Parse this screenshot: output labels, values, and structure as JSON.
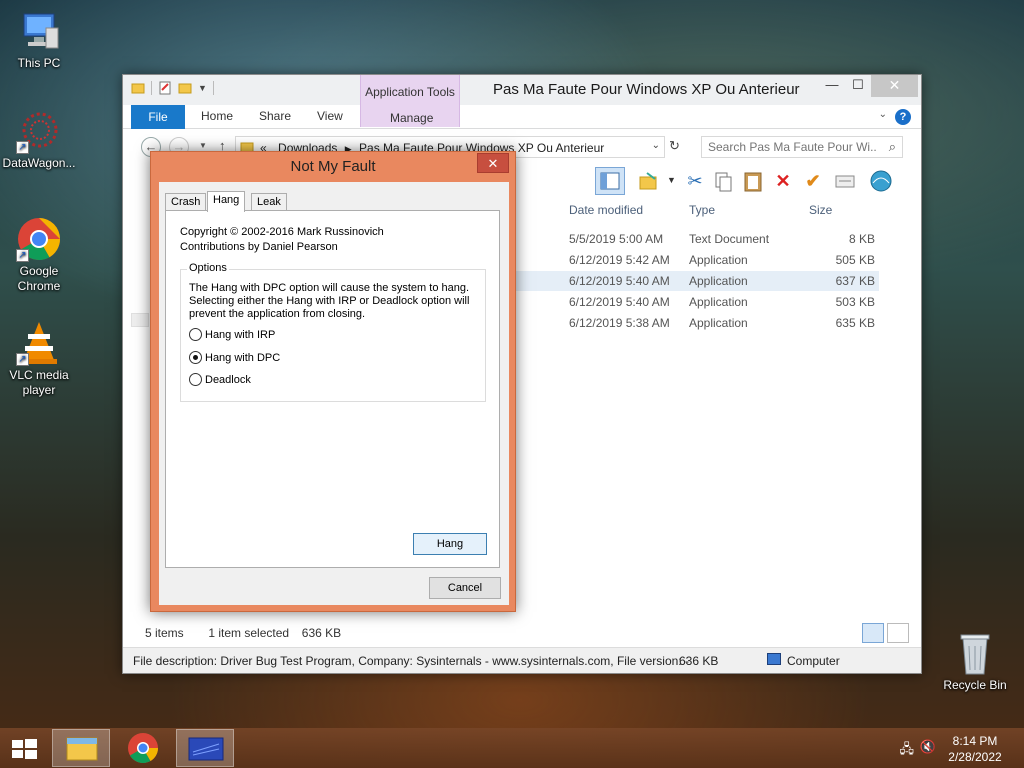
{
  "desktop": {
    "icons": [
      {
        "label": "This PC",
        "icon": "computer-icon"
      },
      {
        "label": "DataWagon...",
        "icon": "datawagon-icon"
      },
      {
        "label": "Google Chrome",
        "icon": "chrome-icon"
      },
      {
        "label": "VLC media player",
        "icon": "vlc-icon"
      },
      {
        "label": "Recycle Bin",
        "icon": "recycle-bin-icon"
      }
    ]
  },
  "explorer": {
    "title": "Pas Ma Faute Pour Windows XP Ou Anterieur",
    "contextual_tab": "Application Tools",
    "ribbon_tabs": [
      "File",
      "Home",
      "Share",
      "View",
      "Manage"
    ],
    "address": {
      "prefix": "«",
      "segments": [
        "Downloads",
        "Pas Ma Faute Pour Windows XP Ou Anterieur"
      ]
    },
    "search_placeholder": "Search Pas Ma Faute Pour Wi...",
    "columns": [
      "Date modified",
      "Type",
      "Size"
    ],
    "files": [
      {
        "date": "5/5/2019 5:00 AM",
        "type": "Text Document",
        "size": "8 KB",
        "selected": false
      },
      {
        "date": "6/12/2019 5:42 AM",
        "type": "Application",
        "size": "505 KB",
        "selected": false
      },
      {
        "date": "6/12/2019 5:40 AM",
        "type": "Application",
        "size": "637 KB",
        "selected": true
      },
      {
        "date": "6/12/2019 5:40 AM",
        "type": "Application",
        "size": "503 KB",
        "selected": false
      },
      {
        "date": "6/12/2019 5:38 AM",
        "type": "Application",
        "size": "635 KB",
        "selected": false
      }
    ],
    "status": {
      "items": "5 items",
      "selected": "1 item selected",
      "size": "636 KB"
    },
    "details": {
      "description": "File description: Driver Bug Test Program, Company: Sysinternals - www.sysinternals.com, File version: -",
      "size": "636 KB",
      "location": "Computer"
    }
  },
  "dialog": {
    "title": "Not My Fault",
    "tabs": [
      "Crash",
      "Hang",
      "Leak"
    ],
    "active_tab": "Hang",
    "copyright": "Copyright © 2002-2016 Mark Russinovich",
    "contributions": "Contributions by Daniel Pearson",
    "group_label": "Options",
    "description_lines": [
      "The Hang with DPC option will cause the system to hang.",
      "Selecting either the Hang with IRP or Deadlock option will",
      "prevent the application from closing."
    ],
    "options": [
      {
        "label": "Hang with IRP",
        "checked": false
      },
      {
        "label": "Hang with DPC",
        "checked": true
      },
      {
        "label": "Deadlock",
        "checked": false
      }
    ],
    "action_button": "Hang",
    "cancel_button": "Cancel"
  },
  "taskbar": {
    "time": "8:14 PM",
    "date": "2/28/2022"
  }
}
